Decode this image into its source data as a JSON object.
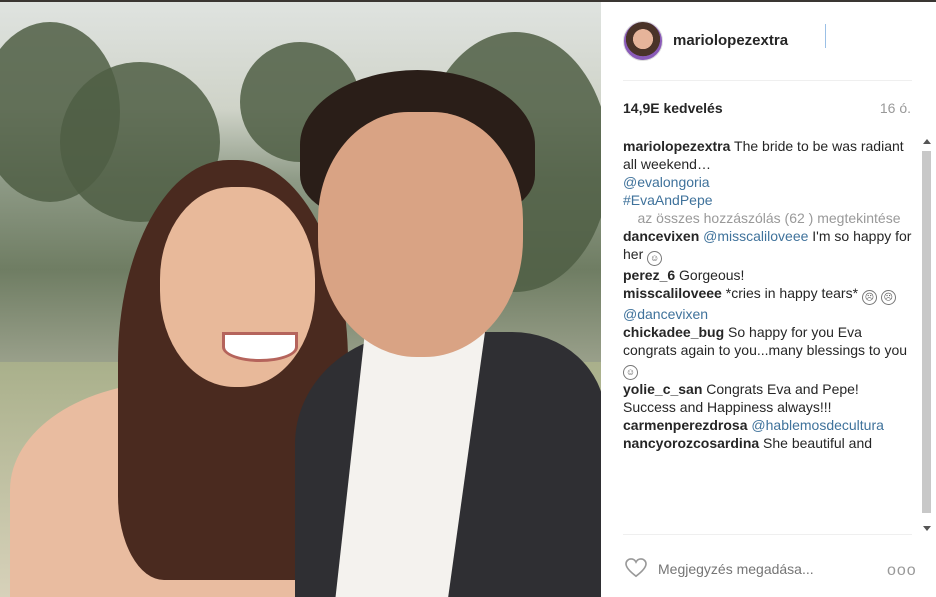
{
  "post": {
    "username": "mariolopezextra",
    "likes": "14,9E kedvelés",
    "age": "16 ó."
  },
  "caption": {
    "username": "mariolopezextra",
    "text": "The bride to be was radiant all weekend…",
    "mention": "@evalongoria",
    "hashtag": "#EvaAndPepe"
  },
  "view_all": "az összes hozzászólás (62 ) megtekintése",
  "comments": [
    {
      "user": "dancevixen",
      "mention": "@misscaliloveee",
      "text": "I'm so happy for her"
    },
    {
      "user": "perez_6",
      "text": "Gorgeous!"
    },
    {
      "user": "misscaliloveee",
      "text": "*cries in happy tears*",
      "mention": "@dancevixen"
    },
    {
      "user": "chickadee_bug",
      "text": "So happy for you Eva congrats again to you...many blessings to you"
    },
    {
      "user": "yolie_c_san",
      "text": "Congrats Eva and Pepe! Success and Happiness always!!!"
    },
    {
      "user": "carmenperezdrosa",
      "mention": "@hablemosdecultura"
    },
    {
      "user": "nancyorozcosardina",
      "text": "She beautiful and"
    }
  ],
  "footer": {
    "comment_placeholder": "Megjegyzés megadása...",
    "more": "ooo"
  },
  "colors": {
    "link": "#3f729b",
    "muted": "#999999"
  },
  "icons": {
    "heart": "heart-icon",
    "more": "more-options-icon"
  }
}
